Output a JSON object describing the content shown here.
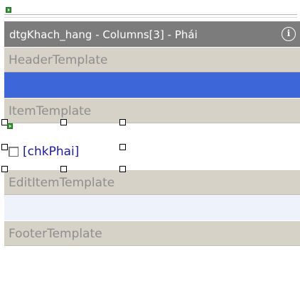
{
  "designer": {
    "title": "dtgKhach_hang - Columns[3] - Phái",
    "info_icon": "info-icon",
    "smart_tag_icon": "smart-tag-icon",
    "sections": {
      "header_template": "HeaderTemplate",
      "item_template": "ItemTemplate",
      "edit_item_template": "EditItemTemplate",
      "footer_template": "FooterTemplate"
    },
    "checkbox_label": "[chkPhai]",
    "colors": {
      "title_bar": "#7c7c7c",
      "section_header": "#d6d2c8",
      "selected_area": "#3d66d8",
      "label_link": "#1a1ab0"
    }
  }
}
